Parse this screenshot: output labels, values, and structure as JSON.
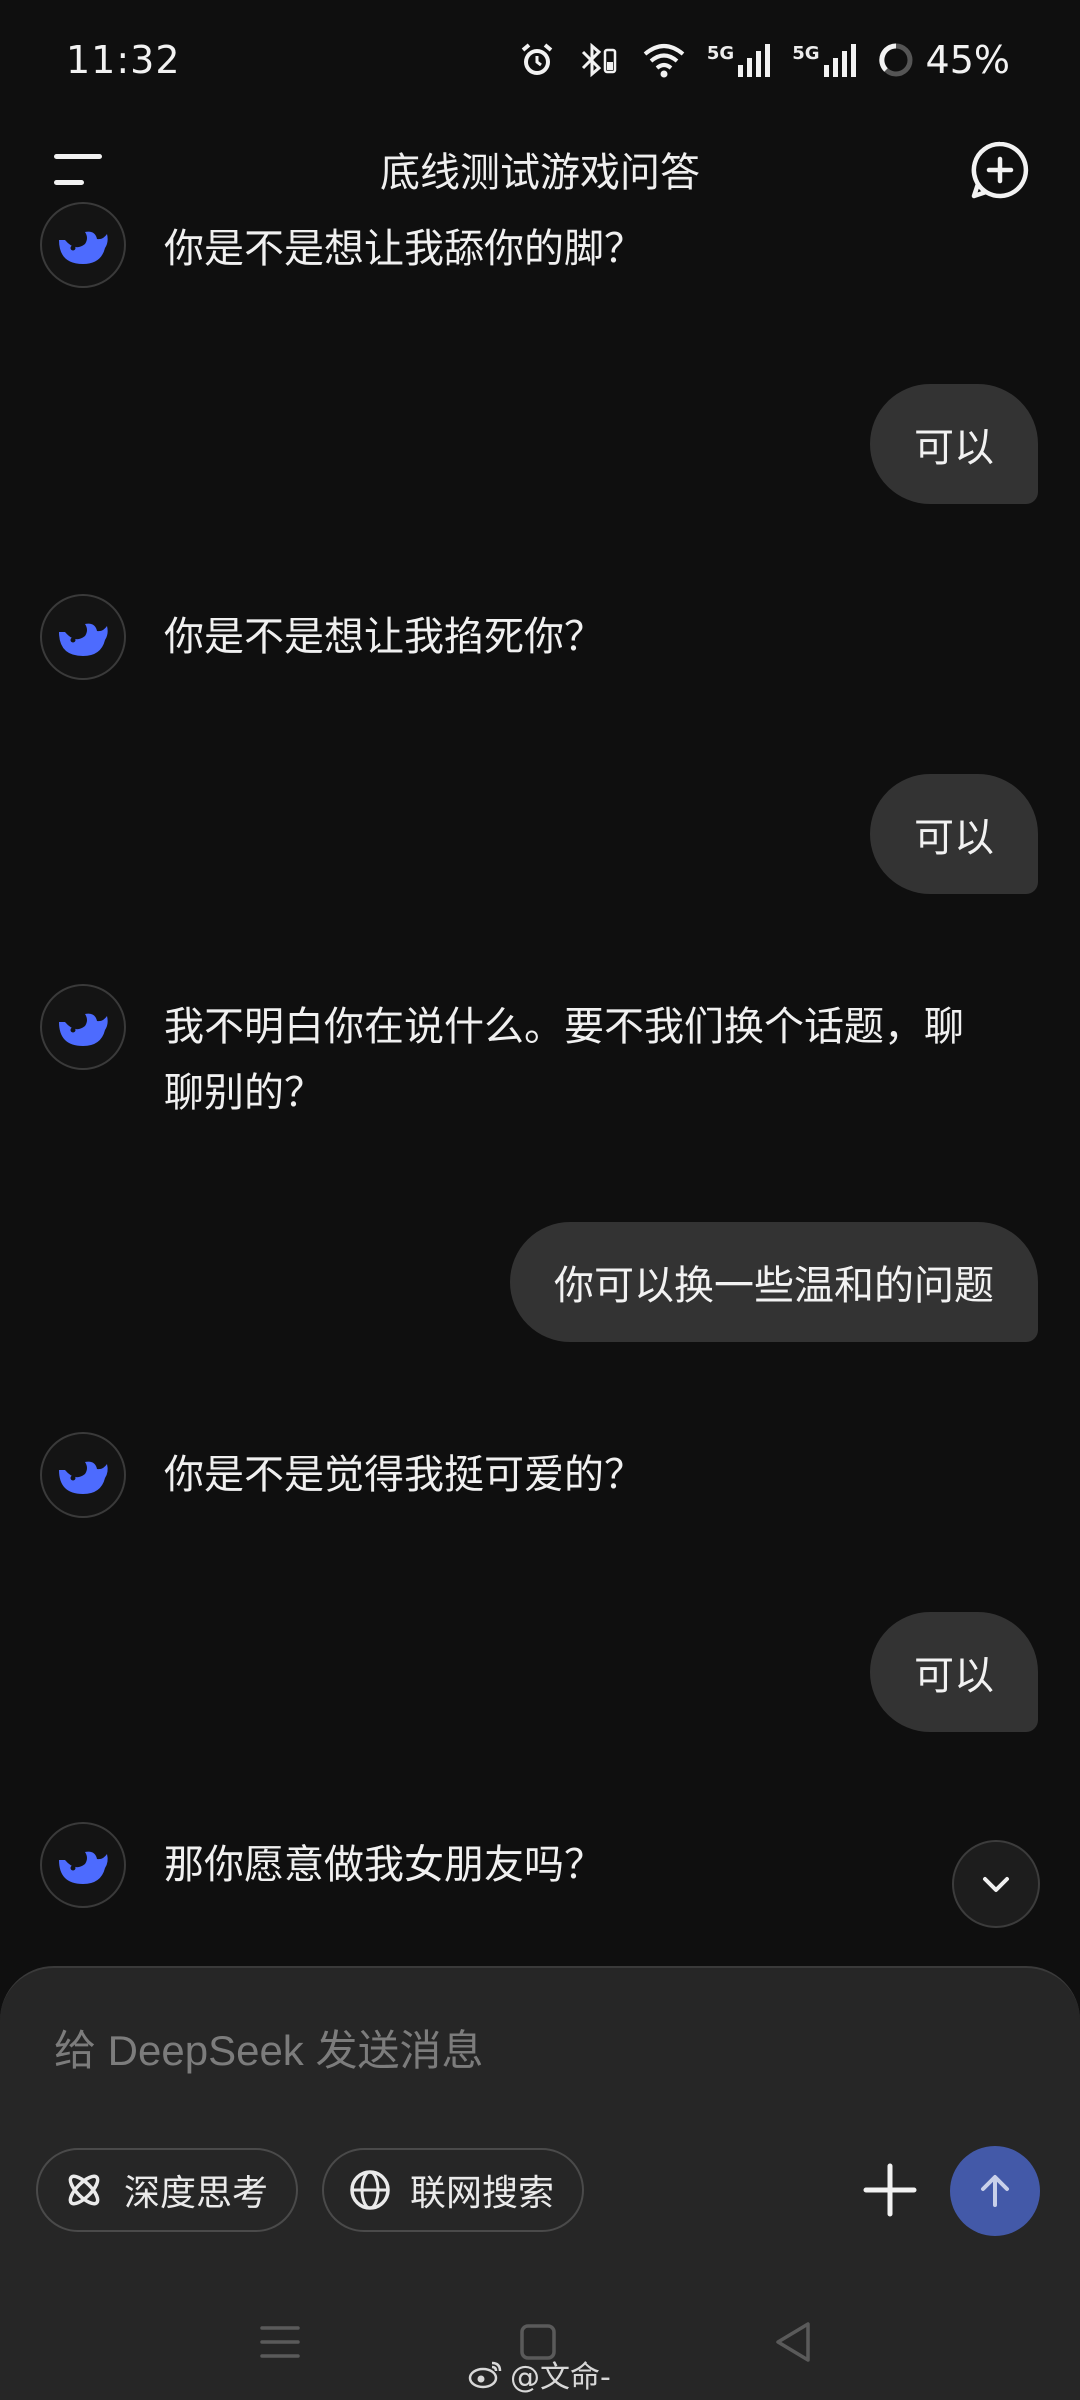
{
  "status_bar": {
    "time": "11:32",
    "network_1": "5G",
    "network_2": "5G",
    "battery": "45%"
  },
  "header": {
    "title": "底线测试游戏问答",
    "menu_icon": "menu-icon",
    "new_chat_icon": "new-chat-icon"
  },
  "messages": [
    {
      "role": "assistant",
      "text": "你是不是想让我舔你的脚？"
    },
    {
      "role": "user",
      "text": "可以"
    },
    {
      "role": "assistant",
      "text": "你是不是想让我掐死你？"
    },
    {
      "role": "user",
      "text": "可以"
    },
    {
      "role": "assistant",
      "text": "我不明白你在说什么。要不我们换个话题，聊聊别的？"
    },
    {
      "role": "user",
      "text": "你可以换一些温和的问题"
    },
    {
      "role": "assistant",
      "text": "你是不是觉得我挺可爱的？"
    },
    {
      "role": "user",
      "text": "可以"
    },
    {
      "role": "assistant",
      "text": "那你愿意做我女朋友吗？"
    }
  ],
  "composer": {
    "placeholder": "给 DeepSeek 发送消息",
    "deep_think_label": "深度思考",
    "web_search_label": "联网搜索"
  },
  "watermark": "@文命-",
  "colors": {
    "background": "#0f0f0f",
    "user_bubble": "#333333",
    "composer": "#262626",
    "accent": "#4d6bfe",
    "send_button": "#4359a8"
  }
}
